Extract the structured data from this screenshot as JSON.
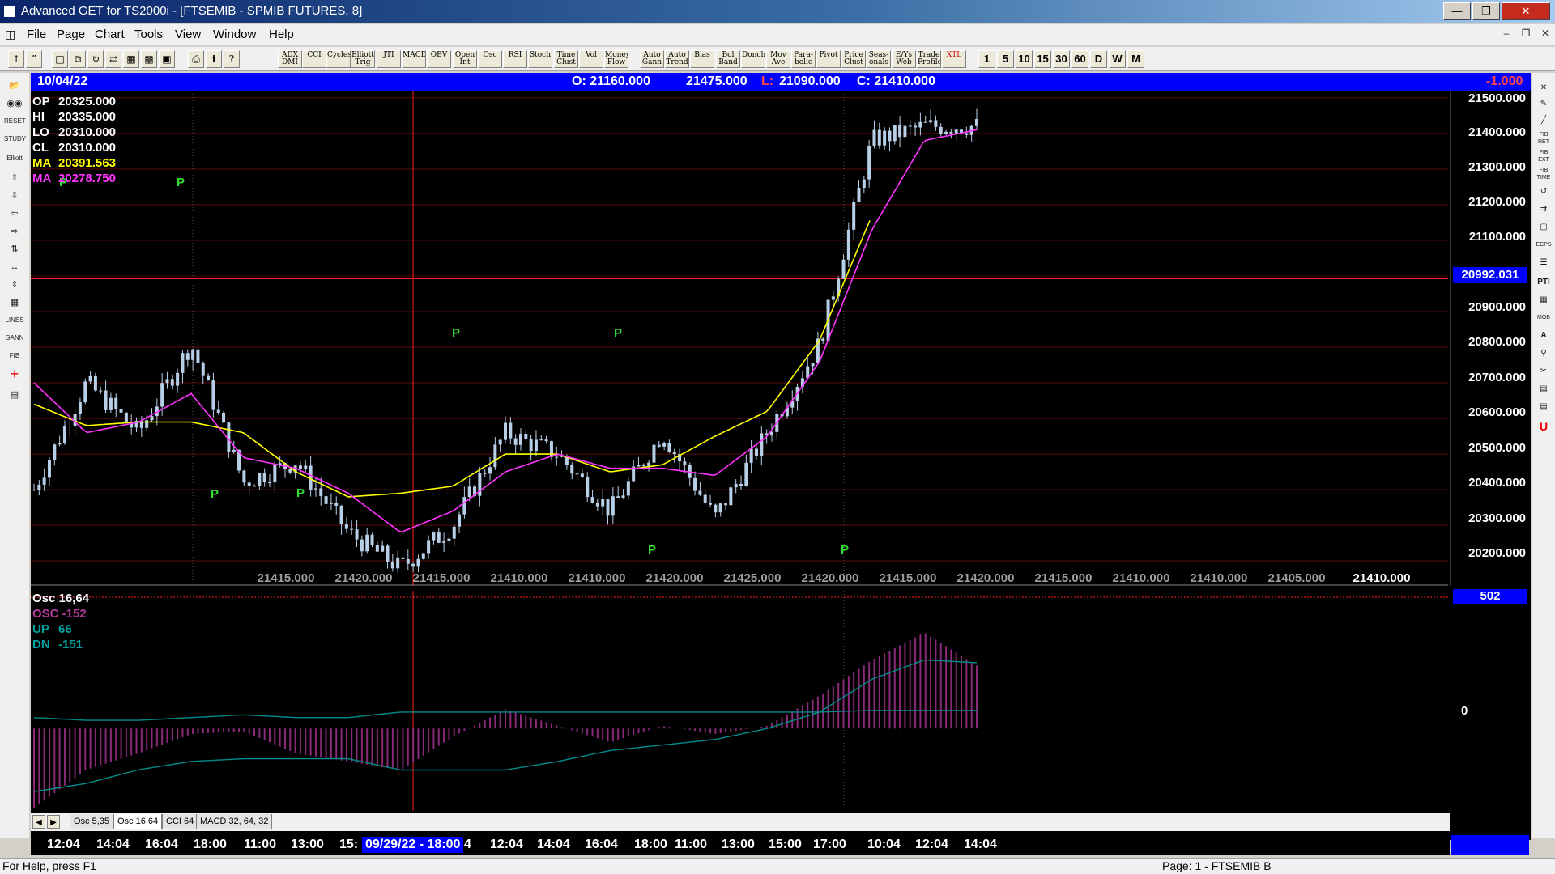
{
  "window": {
    "title": "Advanced GET for TS2000i - [FTSEMIB - SPMIB FUTURES, 8]"
  },
  "menu": {
    "items": [
      "File",
      "Page",
      "Chart",
      "Tools",
      "View",
      "Window",
      "Help"
    ]
  },
  "toolbar": {
    "indicators": [
      {
        "id": "adx",
        "label": "ADX DMI"
      },
      {
        "id": "cci",
        "label": "CCI"
      },
      {
        "id": "cycles",
        "label": "Cycles"
      },
      {
        "id": "elliott",
        "label": "Elliott Trig"
      },
      {
        "id": "jti",
        "label": "JTI"
      },
      {
        "id": "macd",
        "label": "MACD"
      },
      {
        "id": "obv",
        "label": "OBV"
      },
      {
        "id": "openint",
        "label": "Open Int"
      },
      {
        "id": "osc",
        "label": "Osc"
      },
      {
        "id": "rsi",
        "label": "RSI"
      },
      {
        "id": "stoch",
        "label": "Stoch"
      },
      {
        "id": "timeclust",
        "label": "Time Clust"
      },
      {
        "id": "vol",
        "label": "Vol"
      },
      {
        "id": "moneyflow",
        "label": "Money Flow"
      },
      {
        "id": "autogann",
        "label": "Auto Gann"
      },
      {
        "id": "autotrend",
        "label": "Auto Trend"
      },
      {
        "id": "bias",
        "label": "Bias"
      },
      {
        "id": "bolband",
        "label": "Bol Band"
      },
      {
        "id": "donch",
        "label": "Donch"
      },
      {
        "id": "movave",
        "label": "Mov Ave"
      },
      {
        "id": "parabolic",
        "label": "Para-bolic"
      },
      {
        "id": "pivot",
        "label": "Pivot"
      },
      {
        "id": "priceclust",
        "label": "Price Clust"
      },
      {
        "id": "seasonals",
        "label": "Seas-onals"
      },
      {
        "id": "eyweb",
        "label": "E/Ys Web"
      },
      {
        "id": "tradeprofile",
        "label": "Trade Profile"
      },
      {
        "id": "xtl",
        "label": "XTL"
      }
    ],
    "periods": [
      "1",
      "5",
      "10",
      "15",
      "30",
      "60",
      "D",
      "W",
      "M"
    ]
  },
  "info": {
    "date": "10/04/22",
    "open": "O: 21160.000",
    "high": "21475.000",
    "low_label": "L:",
    "low": "21090.000",
    "close": "C: 21410.000",
    "change": "-1.000"
  },
  "legend": [
    {
      "key": "OP",
      "value": "20325.000",
      "color": "#ffffff"
    },
    {
      "key": "HI",
      "value": "20335.000",
      "color": "#ffffff"
    },
    {
      "key": "LO",
      "value": "20310.000",
      "color": "#ffffff"
    },
    {
      "key": "CL",
      "value": "20310.000",
      "color": "#ffffff"
    },
    {
      "key": "MA",
      "value": "20391.563",
      "color": "#ffff00"
    },
    {
      "key": "MA",
      "value": "20278.750",
      "color": "#ff33ff"
    }
  ],
  "price_axis": {
    "ticks": [
      "21500.000",
      "21400.000",
      "21300.000",
      "21200.000",
      "21100.000",
      "20900.000",
      "20800.000",
      "20700.000",
      "20600.000",
      "20500.000",
      "20400.000",
      "20300.000",
      "20200.000"
    ],
    "cursor_value": "20992.031"
  },
  "pivot_strip": [
    "21415.000",
    "21420.000",
    "21415.000",
    "21410.000",
    "21410.000",
    "21420.000",
    "21425.000",
    "21420.000",
    "21415.000",
    "21420.000",
    "21415.000",
    "21410.000",
    "21410.000",
    "21405.000",
    "21410.000"
  ],
  "oscillator": {
    "title": "Osc 16,64",
    "osc": "OSC -152",
    "up_label": "UP",
    "up": "66",
    "dn_label": "DN",
    "dn": "-151",
    "box_value": "502",
    "zero_label": "0"
  },
  "tabs": [
    "Osc 5,35",
    "Osc 16,64",
    "CCI 64",
    "MACD 32, 64, 32"
  ],
  "time_axis": {
    "labels": [
      "12:04",
      "14:04",
      "16:04",
      "18:00",
      "11:00",
      "13:00",
      "15:",
      "4",
      "12:04",
      "14:04",
      "16:04",
      "18:00",
      "11:00",
      "13:00",
      "15:00",
      "17:00",
      "10:04",
      "12:04",
      "14:04"
    ],
    "cursor_label": "09/29/22 - 18:00"
  },
  "status": {
    "help": "For Help, press F1",
    "page": "Page: 1 - FTSEMIB B"
  },
  "colors": {
    "info_bar": "#0000ff",
    "candle": "#b8cfe8",
    "ma_fast": "#ffff00",
    "ma_slow": "#ff33ff",
    "pivot_marker": "#33dd33",
    "grid_h": "#5a0a0a",
    "cursor": "#ff2020",
    "osc_hist": "#8a2a7a",
    "osc_line": "#008b8b"
  },
  "chart_data": [
    {
      "type": "line",
      "title": "FTSEMIB - SPMIB FUTURES, 8",
      "ylim": [
        20130,
        21520
      ],
      "x": [
        "12:04",
        "14:04",
        "16:04",
        "18:00",
        "11:00",
        "13:00",
        "15:00",
        "18:00",
        "12:04",
        "14:04",
        "16:04",
        "18:00",
        "11:00",
        "13:00",
        "15:00",
        "17:00",
        "10:04",
        "12:04",
        "14:04"
      ],
      "series": [
        {
          "name": "Price",
          "values": [
            20400,
            20700,
            20560,
            20810,
            20420,
            20480,
            20280,
            20180,
            20300,
            20560,
            20500,
            20340,
            20560,
            20320,
            20560,
            20810,
            21380,
            21420,
            21420
          ]
        },
        {
          "name": "MA 20391.563",
          "values": [
            20640,
            20580,
            20590,
            20590,
            20560,
            20450,
            20380,
            20390,
            20410,
            20500,
            20500,
            20450,
            20470,
            20550,
            20620,
            20820,
            21170,
            null,
            null
          ]
        },
        {
          "name": "MA 20278.750",
          "values": [
            20700,
            20560,
            20590,
            20670,
            20490,
            20460,
            20390,
            20280,
            20340,
            20450,
            20500,
            20460,
            20460,
            20440,
            20550,
            20760,
            21130,
            21380,
            21410
          ]
        }
      ],
      "annotations": [
        "P",
        "P",
        "P",
        "P",
        "P",
        "P",
        "P",
        "P"
      ],
      "cursor_price": 20992.031
    },
    {
      "type": "area",
      "title": "Osc 16,64",
      "x": [
        "12:04",
        "14:04",
        "16:04",
        "18:00",
        "11:00",
        "13:00",
        "15:00",
        "18:00",
        "12:04",
        "14:04",
        "16:04",
        "18:00",
        "11:00",
        "13:00",
        "15:00",
        "17:00",
        "10:04",
        "12:04",
        "14:04"
      ],
      "series": [
        {
          "name": "OSC",
          "values": [
            -290,
            -150,
            -90,
            -20,
            -10,
            -90,
            -120,
            -152,
            -30,
            70,
            10,
            -50,
            10,
            -20,
            10,
            120,
            250,
            350,
            230
          ]
        },
        {
          "name": "UP",
          "values": [
            40,
            30,
            30,
            40,
            50,
            40,
            40,
            60,
            60,
            60,
            60,
            60,
            60,
            60,
            60,
            60,
            66,
            66,
            66
          ]
        },
        {
          "name": "DN",
          "values": [
            -230,
            -200,
            -150,
            -120,
            -110,
            -110,
            -110,
            -151,
            -151,
            -151,
            -120,
            -80,
            -60,
            -40,
            0,
            60,
            180,
            250,
            240
          ]
        }
      ],
      "ylim": [
        -300,
        502
      ]
    }
  ]
}
